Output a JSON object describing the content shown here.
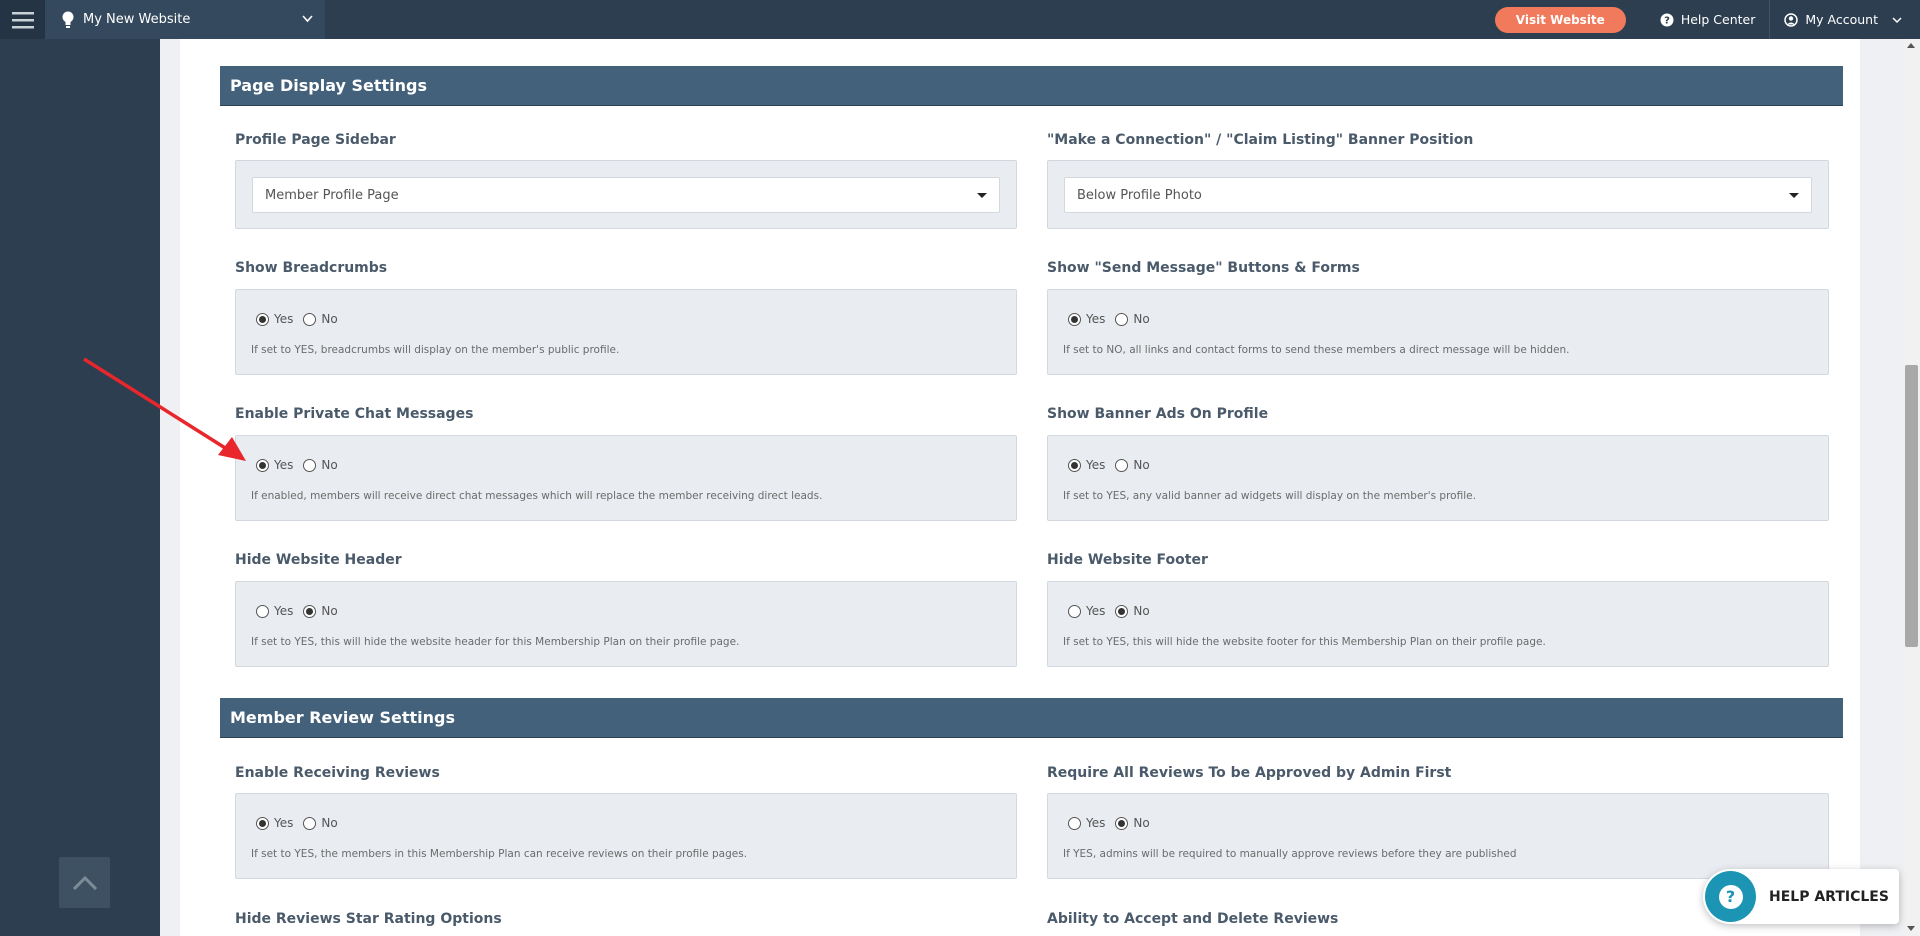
{
  "topbar": {
    "site_name": "My New Website",
    "visit_label": "Visit Website",
    "help_center_label": "Help Center",
    "account_label": "My Account"
  },
  "sections": {
    "page_display": "Page Display Settings",
    "member_review": "Member Review Settings"
  },
  "fields": {
    "profile_sidebar": {
      "label": "Profile Page Sidebar",
      "value": "Member Profile Page"
    },
    "banner_position": {
      "label": "\"Make a Connection\" / \"Claim Listing\" Banner Position",
      "value": "Below Profile Photo"
    },
    "breadcrumbs": {
      "label": "Show Breadcrumbs",
      "selected": "Yes",
      "help": "If set to YES, breadcrumbs will display on the member's public profile."
    },
    "send_message": {
      "label": "Show \"Send Message\" Buttons & Forms",
      "selected": "Yes",
      "help": "If set to NO, all links and contact forms to send these members a direct message will be hidden."
    },
    "private_chat": {
      "label": "Enable Private Chat Messages",
      "selected": "Yes",
      "help": "If enabled, members will receive direct chat messages which will replace the member receiving direct leads."
    },
    "banner_ads": {
      "label": "Show Banner Ads On Profile",
      "selected": "Yes",
      "help": "If set to YES, any valid banner ad widgets will display on the member's profile."
    },
    "hide_header": {
      "label": "Hide Website Header",
      "selected": "No",
      "help": "If set to YES, this will hide the website header for this Membership Plan on their profile page."
    },
    "hide_footer": {
      "label": "Hide Website Footer",
      "selected": "No",
      "help": "If set to YES, this will hide the website footer for this Membership Plan on their profile page."
    },
    "receiving_reviews": {
      "label": "Enable Receiving Reviews",
      "selected": "Yes",
      "help": "If set to YES, the members in this Membership Plan can receive reviews on their profile pages."
    },
    "approve_reviews": {
      "label": "Require All Reviews To be Approved by Admin First",
      "selected": "No",
      "help": "If YES, admins will be required to manually approve reviews before they are published"
    },
    "hide_star_rating": {
      "label": "Hide Reviews Star Rating Options"
    },
    "accept_delete_reviews": {
      "label": "Ability to Accept and Delete Reviews"
    }
  },
  "radio_options": {
    "yes": "Yes",
    "no": "No"
  },
  "help_widget": {
    "label": "HELP ARTICLES",
    "icon_glyph": "?"
  },
  "colors": {
    "topbar": "#2c3e50",
    "visit_button": "#f07a5b",
    "section_header": "#44617b",
    "help_widget_icon": "#1b95b3",
    "annotation_arrow": "#e8262b"
  }
}
